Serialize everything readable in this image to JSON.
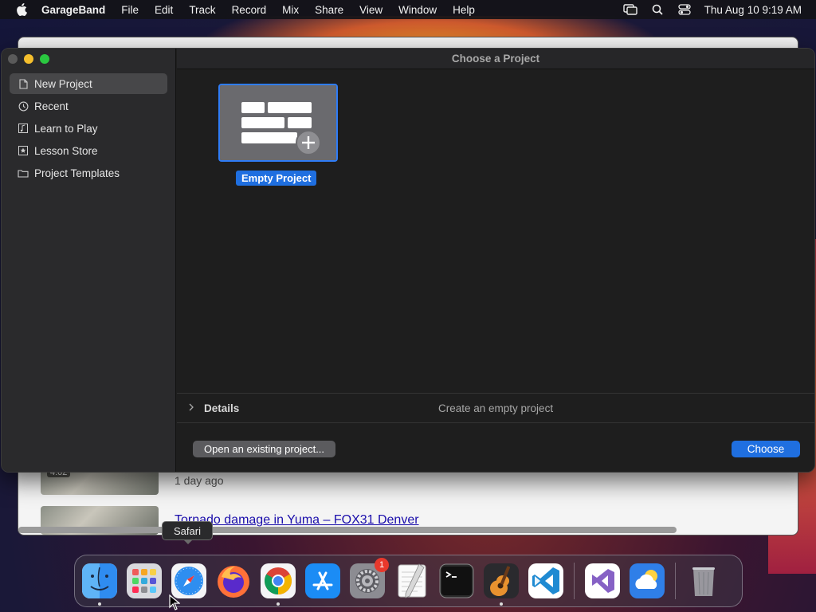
{
  "menubar": {
    "app_name": "GarageBand",
    "items": [
      "File",
      "Edit",
      "Track",
      "Record",
      "Mix",
      "Share",
      "View",
      "Window",
      "Help"
    ],
    "clock": "Thu Aug 10  9:19 AM",
    "status_icons": [
      "screen-mirroring-icon",
      "search-icon",
      "control-center-icon"
    ]
  },
  "background_window": {
    "row1": {
      "duration": "4:02",
      "meta": "1 day ago"
    },
    "row2": {
      "title": "Tornado damage in Yuma – FOX31 Denver"
    }
  },
  "dialog": {
    "title": "Choose a Project",
    "sidebar": [
      {
        "label": "New Project",
        "icon": "document-icon",
        "selected": true
      },
      {
        "label": "Recent",
        "icon": "clock-icon",
        "selected": false
      },
      {
        "label": "Learn to Play",
        "icon": "music-note-icon",
        "selected": false
      },
      {
        "label": "Lesson Store",
        "icon": "star-icon",
        "selected": false
      },
      {
        "label": "Project Templates",
        "icon": "folder-icon",
        "selected": false
      }
    ],
    "project": {
      "label": "Empty Project"
    },
    "details": {
      "label": "Details",
      "description": "Create an empty project"
    },
    "buttons": {
      "open_existing": "Open an existing project...",
      "choose": "Choose"
    }
  },
  "tooltip": {
    "text": "Safari"
  },
  "dock": {
    "apps": [
      {
        "name": "Finder",
        "icon": "finder-icon",
        "running": true
      },
      {
        "name": "Launchpad",
        "icon": "launchpad-icon",
        "running": false
      },
      {
        "name": "Safari",
        "icon": "safari-icon",
        "running": false
      },
      {
        "name": "Firefox",
        "icon": "firefox-icon",
        "running": false
      },
      {
        "name": "Chrome",
        "icon": "chrome-icon",
        "running": true
      },
      {
        "name": "App Store",
        "icon": "app-store-icon",
        "running": false
      },
      {
        "name": "System Settings",
        "icon": "system-settings-icon",
        "running": false,
        "badge": "1"
      },
      {
        "name": "TextEdit",
        "icon": "textedit-icon",
        "running": false
      },
      {
        "name": "Terminal",
        "icon": "terminal-icon",
        "running": false
      },
      {
        "name": "GarageBand",
        "icon": "garageband-icon",
        "running": true
      },
      {
        "name": "Visual Studio Code",
        "icon": "vscode-icon",
        "running": false
      },
      {
        "name": "Visual Studio",
        "icon": "visual-studio-icon",
        "running": false
      },
      {
        "name": "Weather",
        "icon": "weather-icon",
        "running": false
      },
      {
        "name": "Trash",
        "icon": "trash-icon",
        "running": false
      }
    ]
  },
  "colors": {
    "accent": "#1f6fe0",
    "badge": "#e8382c"
  }
}
